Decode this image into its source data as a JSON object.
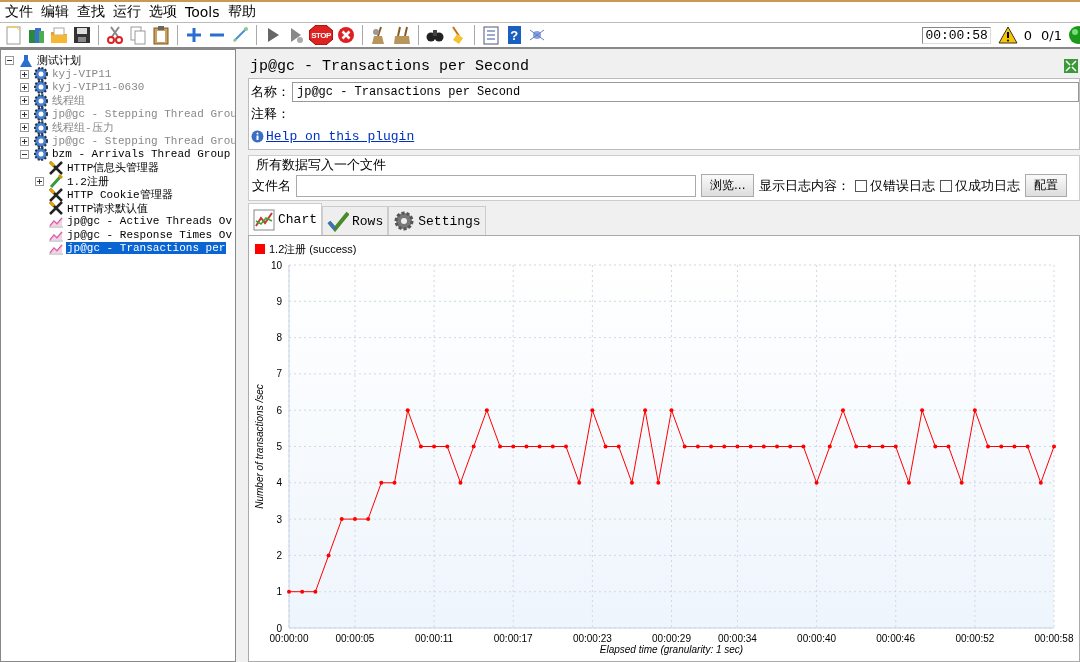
{
  "menu": [
    "文件",
    "编辑",
    "查找",
    "运行",
    "选项",
    "Tools",
    "帮助"
  ],
  "toolbar": [
    {
      "kind": "new"
    },
    {
      "kind": "templates"
    },
    {
      "kind": "open"
    },
    {
      "kind": "save"
    },
    {
      "kind": "sep"
    },
    {
      "kind": "cut"
    },
    {
      "kind": "copy"
    },
    {
      "kind": "paste"
    },
    {
      "kind": "sep"
    },
    {
      "kind": "expand"
    },
    {
      "kind": "collapse"
    },
    {
      "kind": "toggle"
    },
    {
      "kind": "sep"
    },
    {
      "kind": "start"
    },
    {
      "kind": "start-no-timers"
    },
    {
      "kind": "stop",
      "glyph": "STOP"
    },
    {
      "kind": "shutdown"
    },
    {
      "kind": "sep"
    },
    {
      "kind": "clear"
    },
    {
      "kind": "clear-all"
    },
    {
      "kind": "sep"
    },
    {
      "kind": "search"
    },
    {
      "kind": "reset-search"
    },
    {
      "kind": "sep"
    },
    {
      "kind": "functions"
    },
    {
      "kind": "help",
      "glyph": "?"
    },
    {
      "kind": "remote"
    }
  ],
  "status": {
    "elapsed": "00:00:58",
    "warnings": "0",
    "threads": "0/1"
  },
  "tree": {
    "label": "测试计划",
    "kind": "plan",
    "expanded": true,
    "disabled": false,
    "selected": false,
    "children": [
      {
        "label": "kyj-VIP11",
        "kind": "thread-group",
        "expanded": false,
        "disabled": true,
        "selected": false
      },
      {
        "label": "kyj-VIP11-0630",
        "kind": "thread-group",
        "expanded": false,
        "disabled": true,
        "selected": false
      },
      {
        "label": "线程组",
        "kind": "thread-group",
        "expanded": false,
        "disabled": true,
        "selected": false
      },
      {
        "label": "jp@gc - Stepping Thread Grou",
        "kind": "thread-group",
        "expanded": false,
        "disabled": true,
        "selected": false
      },
      {
        "label": "线程组-压力",
        "kind": "thread-group",
        "expanded": false,
        "disabled": true,
        "selected": false
      },
      {
        "label": "jp@gc - Stepping Thread Grou",
        "kind": "thread-group",
        "expanded": false,
        "disabled": true,
        "selected": false
      },
      {
        "label": "bzm - Arrivals Thread Group",
        "kind": "thread-group",
        "expanded": true,
        "disabled": false,
        "selected": false,
        "children": [
          {
            "label": "HTTP信息头管理器",
            "kind": "config",
            "disabled": false,
            "selected": false
          },
          {
            "label": "1.2注册",
            "kind": "sampler",
            "expanded": false,
            "disabled": false,
            "selected": false
          },
          {
            "label": "HTTP Cookie管理器",
            "kind": "config",
            "disabled": false,
            "selected": false
          },
          {
            "label": "HTTP请求默认值",
            "kind": "config",
            "disabled": false,
            "selected": false
          },
          {
            "label": "jp@gc - Active Threads Ov",
            "kind": "listener",
            "disabled": false,
            "selected": false
          },
          {
            "label": "jp@gc - Response Times Ov",
            "kind": "listener",
            "disabled": false,
            "selected": false
          },
          {
            "label": "jp@gc - Transactions per",
            "kind": "listener",
            "disabled": false,
            "selected": true
          }
        ]
      }
    ]
  },
  "panel": {
    "title": "jp@gc - Transactions per Second",
    "name_label": "名称：",
    "name_value": "jp@gc - Transactions per Second",
    "comment_label": "注释：",
    "help_link": "Help on this plugin"
  },
  "file_section": {
    "legend": "所有数据写入一个文件",
    "file_label": "文件名",
    "browse_button": "浏览...",
    "log_label": "显示日志内容：",
    "checkboxes": [
      {
        "label": "仅错误日志",
        "checked": false
      },
      {
        "label": "仅成功日志",
        "checked": false
      }
    ],
    "config_button": "配置"
  },
  "tabs": [
    {
      "label": "Chart",
      "kind": "chart",
      "selected": true
    },
    {
      "label": "Rows",
      "kind": "rows",
      "selected": false
    },
    {
      "label": "Settings",
      "kind": "settings",
      "selected": false
    }
  ],
  "chart": {
    "chart_data": {
      "type": "line",
      "grid": true,
      "xlabel": "Elapsed time (granularity: 1 sec)",
      "ylabel": "Number of transactions /sec",
      "x": [
        0,
        1,
        2,
        3,
        4,
        5,
        6,
        7,
        8,
        9,
        10,
        11,
        12,
        13,
        14,
        15,
        16,
        17,
        18,
        19,
        20,
        21,
        22,
        23,
        24,
        25,
        26,
        27,
        28,
        29,
        30,
        31,
        32,
        33,
        34,
        35,
        36,
        37,
        38,
        39,
        40,
        41,
        42,
        43,
        44,
        45,
        46,
        47,
        48,
        49,
        50,
        51,
        52,
        53,
        54,
        55,
        56,
        57,
        58
      ],
      "series": [
        {
          "name": "1.2注册 (success)",
          "color": "#ff0000",
          "values": [
            1,
            1,
            1,
            2,
            3,
            3,
            3,
            4,
            4,
            6,
            5,
            5,
            5,
            4,
            5,
            6,
            5,
            5,
            5,
            5,
            5,
            5,
            4,
            6,
            5,
            5,
            4,
            6,
            4,
            6,
            5,
            5,
            5,
            5,
            5,
            5,
            5,
            5,
            5,
            5,
            4,
            5,
            6,
            5,
            5,
            5,
            5,
            4,
            6,
            5,
            5,
            4,
            6,
            5,
            5,
            5,
            5,
            4,
            5
          ]
        }
      ],
      "xlim": [
        0,
        58
      ],
      "ylim": [
        0,
        10
      ],
      "xticks": [
        {
          "value": 0,
          "label": "00:00:00"
        },
        {
          "value": 5,
          "label": "00:00:05"
        },
        {
          "value": 11,
          "label": "00:00:11"
        },
        {
          "value": 17,
          "label": "00:00:17"
        },
        {
          "value": 23,
          "label": "00:00:23"
        },
        {
          "value": 29,
          "label": "00:00:29"
        },
        {
          "value": 34,
          "label": "00:00:34"
        },
        {
          "value": 40,
          "label": "00:00:40"
        },
        {
          "value": 46,
          "label": "00:00:46"
        },
        {
          "value": 52,
          "label": "00:00:52"
        },
        {
          "value": 58,
          "label": "00:00:58"
        }
      ],
      "yticks": [
        0,
        1,
        2,
        3,
        4,
        5,
        6,
        7,
        8,
        9,
        10
      ]
    }
  }
}
